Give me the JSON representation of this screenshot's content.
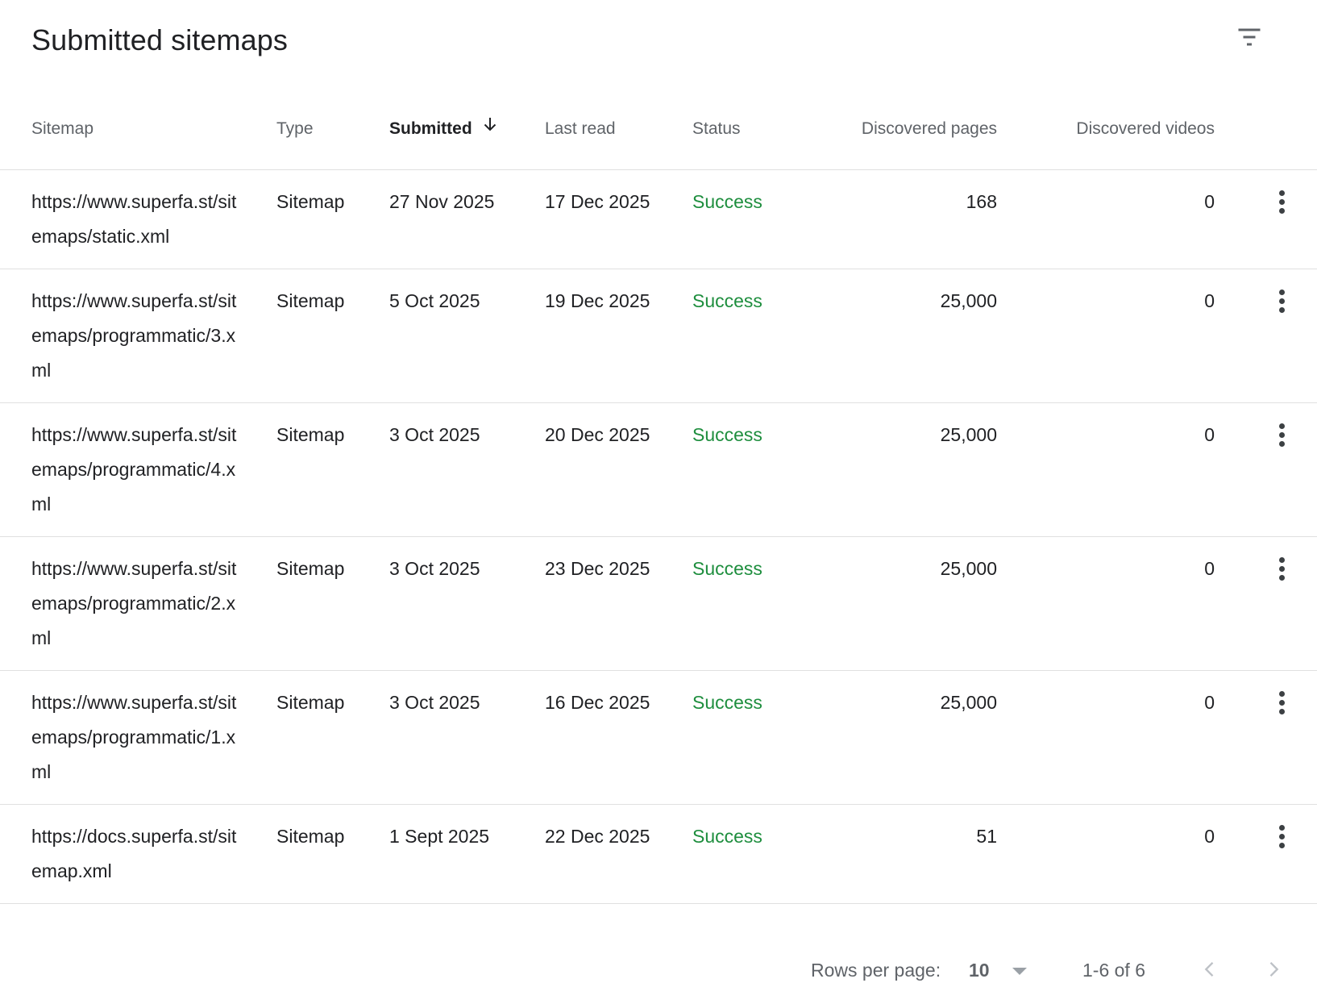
{
  "title": "Submitted sitemaps",
  "columns": {
    "sitemap": "Sitemap",
    "type": "Type",
    "submitted": "Submitted",
    "last_read": "Last read",
    "status": "Status",
    "discovered_pages": "Discovered pages",
    "discovered_videos": "Discovered videos"
  },
  "sort": {
    "column": "submitted",
    "direction": "descending"
  },
  "rows": [
    {
      "sitemap": "https://www.superfa.st/sitemaps/static.xml",
      "type": "Sitemap",
      "submitted": "27 Nov 2025",
      "last_read": "17 Dec 2025",
      "status": "Success",
      "pages": "168",
      "videos": "0"
    },
    {
      "sitemap": "https://www.superfa.st/sitemaps/programmatic/3.xml",
      "type": "Sitemap",
      "submitted": "5 Oct 2025",
      "last_read": "19 Dec 2025",
      "status": "Success",
      "pages": "25,000",
      "videos": "0"
    },
    {
      "sitemap": "https://www.superfa.st/sitemaps/programmatic/4.xml",
      "type": "Sitemap",
      "submitted": "3 Oct 2025",
      "last_read": "20 Dec 2025",
      "status": "Success",
      "pages": "25,000",
      "videos": "0"
    },
    {
      "sitemap": "https://www.superfa.st/sitemaps/programmatic/2.xml",
      "type": "Sitemap",
      "submitted": "3 Oct 2025",
      "last_read": "23 Dec 2025",
      "status": "Success",
      "pages": "25,000",
      "videos": "0"
    },
    {
      "sitemap": "https://www.superfa.st/sitemaps/programmatic/1.xml",
      "type": "Sitemap",
      "submitted": "3 Oct 2025",
      "last_read": "16 Dec 2025",
      "status": "Success",
      "pages": "25,000",
      "videos": "0"
    },
    {
      "sitemap": "https://docs.superfa.st/sitemap.xml",
      "type": "Sitemap",
      "submitted": "1 Sept 2025",
      "last_read": "22 Dec 2025",
      "status": "Success",
      "pages": "51",
      "videos": "0"
    }
  ],
  "pagination": {
    "rows_per_page_label": "Rows per page:",
    "rows_per_page": "10",
    "range": "1-6 of 6"
  },
  "colors": {
    "success": "#1e8e3e",
    "text": "#202124",
    "muted": "#5f6368",
    "divider": "#e0e0e0"
  },
  "icons": {
    "filter": "filter-icon",
    "sort": "arrow-down-icon",
    "row_menu": "more-vert-icon",
    "prev": "chevron-left-icon",
    "next": "chevron-right-icon",
    "dropdown": "caret-down-icon"
  }
}
